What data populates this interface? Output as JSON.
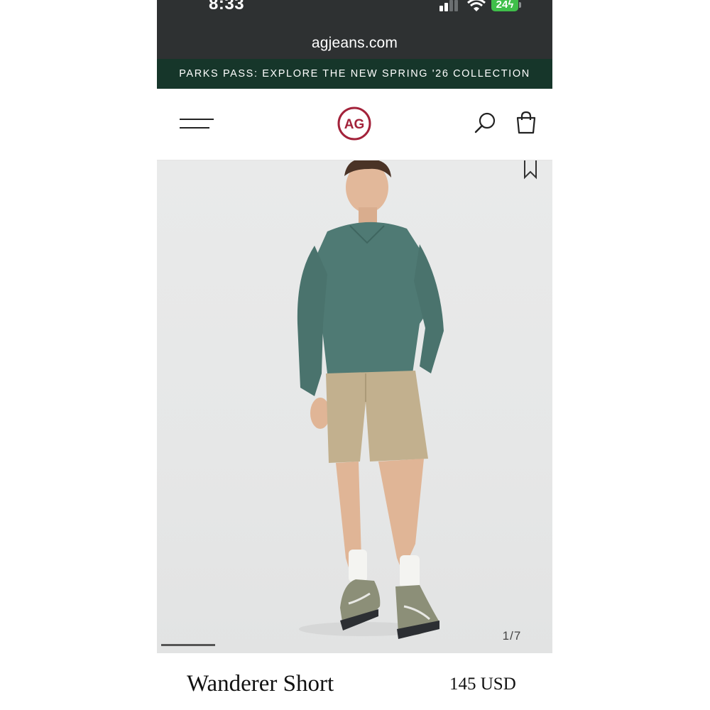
{
  "status_bar": {
    "time": "8:33",
    "battery_level": "24",
    "signal_icon": "cellular-signal-icon",
    "wifi_icon": "wifi-icon"
  },
  "browser": {
    "url": "agjeans.com"
  },
  "promo_banner": {
    "text": "PARKS PASS: EXPLORE THE NEW SPRING '26 COLLECTION"
  },
  "header": {
    "logo_text": "AG",
    "menu_icon": "hamburger-menu-icon",
    "search_icon": "search-icon",
    "bag_icon": "shopping-bag-icon"
  },
  "gallery": {
    "counter": "1/7",
    "current_index": 1,
    "total": 7,
    "bookmark_icon": "bookmark-icon"
  },
  "product": {
    "name": "Wanderer Short",
    "price": "145 USD"
  },
  "colors": {
    "status_bg": "#2e3132",
    "promo_bg": "#16362a",
    "logo_red": "#a3223a",
    "sweater": "#4f7a74",
    "shorts": "#c2b08e"
  }
}
